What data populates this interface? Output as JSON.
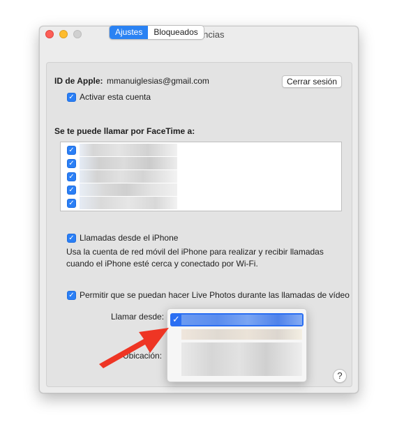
{
  "window": {
    "title": "Preferencias"
  },
  "tabs": [
    {
      "label": "Ajustes",
      "active": true
    },
    {
      "label": "Bloqueados",
      "active": false
    }
  ],
  "account": {
    "label": "ID de Apple:",
    "email": "mmanuiglesias@gmail.com",
    "signout_label": "Cerrar sesión",
    "enable_label": "Activar esta cuenta",
    "enable_checked": true
  },
  "facetime": {
    "heading": "Se te puede llamar por FaceTime a:",
    "addresses_checked": [
      true,
      true,
      true,
      true,
      true
    ]
  },
  "iphone_calls": {
    "label": "Llamadas desde el iPhone",
    "checked": true,
    "description": "Usa la cuenta de red móvil del iPhone para realizar y recibir llamadas cuando el iPhone esté cerca y conectado por Wi-Fi."
  },
  "live_photos": {
    "label": "Permitir que se puedan hacer Live Photos durante las llamadas de vídeo",
    "checked": true
  },
  "call_from": {
    "label": "Llamar desde:"
  },
  "location": {
    "label": "Ubicación:"
  },
  "help": {
    "label": "?"
  },
  "colors": {
    "accent": "#2a82f3",
    "arrow": "#ee3524"
  }
}
